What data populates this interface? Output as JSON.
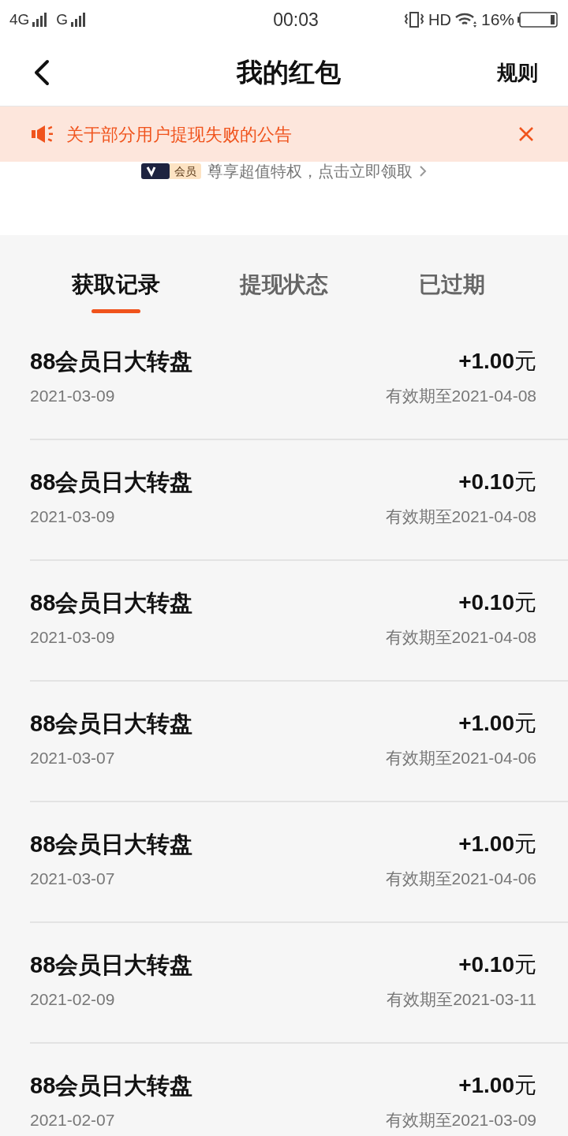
{
  "status_bar": {
    "network_1": "4G",
    "network_2": "G",
    "time": "00:03",
    "hd": "HD",
    "battery": "16%"
  },
  "header": {
    "title": "我的红包",
    "action": "规则"
  },
  "notice": {
    "text": "关于部分用户提现失败的公告"
  },
  "promo": {
    "badge": "会员",
    "text": "尊享超值特权，点击立即领取"
  },
  "tabs": [
    {
      "label": "获取记录",
      "selected": true
    },
    {
      "label": "提现状态",
      "selected": false
    },
    {
      "label": "已过期",
      "selected": false
    }
  ],
  "records": [
    {
      "title": "88会员日大转盘",
      "date": "2021-03-09",
      "amount": "+1.00",
      "unit": "元",
      "expiry": "有效期至2021-04-08"
    },
    {
      "title": "88会员日大转盘",
      "date": "2021-03-09",
      "amount": "+0.10",
      "unit": "元",
      "expiry": "有效期至2021-04-08"
    },
    {
      "title": "88会员日大转盘",
      "date": "2021-03-09",
      "amount": "+0.10",
      "unit": "元",
      "expiry": "有效期至2021-04-08"
    },
    {
      "title": "88会员日大转盘",
      "date": "2021-03-07",
      "amount": "+1.00",
      "unit": "元",
      "expiry": "有效期至2021-04-06"
    },
    {
      "title": "88会员日大转盘",
      "date": "2021-03-07",
      "amount": "+1.00",
      "unit": "元",
      "expiry": "有效期至2021-04-06"
    },
    {
      "title": "88会员日大转盘",
      "date": "2021-02-09",
      "amount": "+0.10",
      "unit": "元",
      "expiry": "有效期至2021-03-11"
    },
    {
      "title": "88会员日大转盘",
      "date": "2021-02-07",
      "amount": "+1.00",
      "unit": "元",
      "expiry": "有效期至2021-03-09"
    }
  ]
}
